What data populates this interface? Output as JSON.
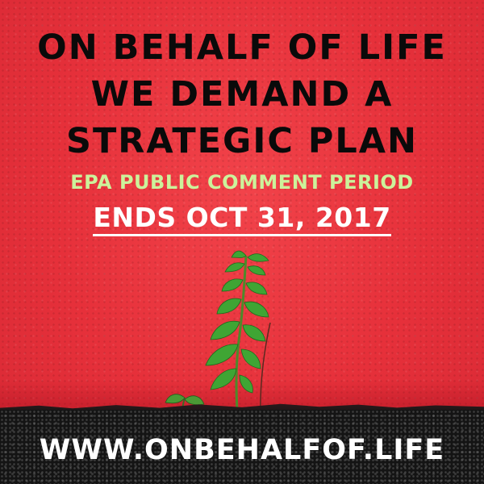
{
  "headline": {
    "line1": "ON BEHALF OF LIFE",
    "line2": "WE DEMAND A",
    "line3": "STRATEGIC PLAN"
  },
  "subhead": "EPA PUBLIC COMMENT PERIOD",
  "deadline": "ENDS OCT 31, 2017",
  "url": "WWW.ONBEHALFOF.LIFE",
  "colors": {
    "wall": "#e8323c",
    "headline": "#0a0a0a",
    "subhead": "#ccf29b",
    "deadline": "#ffffff",
    "url": "#ffffff",
    "ground": "#141414",
    "plant": "#3fa534"
  },
  "image": {
    "subject": "young green plant growing at base of red wall"
  }
}
